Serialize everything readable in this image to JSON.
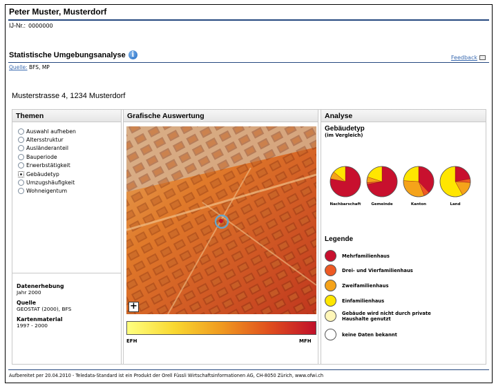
{
  "header": {
    "name": "Peter Muster, Musterdorf",
    "id_label": "IJ-Nr.:",
    "id_value": "0000000"
  },
  "section": {
    "title": "Statistische Umgebungsanalyse",
    "feedback": "Feedback",
    "source_link": "Quelle:",
    "source_value": "BFS, MP"
  },
  "address": "Musterstrasse 4, 1234 Musterdorf",
  "panels": {
    "themes_header": "Themen",
    "map_header": "Grafische Auswertung",
    "analysis_header": "Analyse"
  },
  "themes": [
    {
      "label": "Auswahl aufheben",
      "checked": false
    },
    {
      "label": "Altersstruktur",
      "checked": false
    },
    {
      "label": "Ausländeranteil",
      "checked": false
    },
    {
      "label": "Bauperiode",
      "checked": false
    },
    {
      "label": "Erwerbstätigkeit",
      "checked": false
    },
    {
      "label": "Gebäudetyp",
      "checked": true
    },
    {
      "label": "Umzugshäufigkeit",
      "checked": false
    },
    {
      "label": "Wohneigentum",
      "checked": false
    }
  ],
  "meta": {
    "erhebung_label": "Datenerhebung",
    "erhebung_value": "Jahr 2000",
    "quelle_label": "Quelle",
    "quelle_value": "GEOSTAT (2000), BFS",
    "karten_label": "Kartenmaterial",
    "karten_value": "1997 - 2000"
  },
  "map": {
    "zoom_button": "+",
    "scale_left": "EFH",
    "scale_right": "MFH"
  },
  "analysis": {
    "title": "Gebäudetyp",
    "subtitle": "(im Vergleich)",
    "pies": [
      {
        "label": "Nachbarschaft",
        "shares": [
          0.78,
          0.0,
          0.08,
          0.14,
          0.0
        ]
      },
      {
        "label": "Gemeinde",
        "shares": [
          0.72,
          0.02,
          0.06,
          0.2,
          0.0
        ]
      },
      {
        "label": "Kanton",
        "shares": [
          0.38,
          0.06,
          0.32,
          0.24,
          0.0
        ]
      },
      {
        "label": "Land",
        "shares": [
          0.22,
          0.04,
          0.16,
          0.58,
          0.0
        ]
      }
    ],
    "legend_title": "Legende",
    "legend": [
      {
        "label": "Mehrfamilienhaus",
        "color": "#c8102e"
      },
      {
        "label": "Drei- und Vierfamilienhaus",
        "color": "#ee5a24"
      },
      {
        "label": "Zweifamilienhaus",
        "color": "#f5a31a"
      },
      {
        "label": "Einfamilienhaus",
        "color": "#ffe600"
      },
      {
        "label": "Gebäude wird nicht durch private Haushalte genutzt",
        "color": "#fff6b8"
      },
      {
        "label": "keine Daten bekannt",
        "color": "#ffffff"
      }
    ]
  },
  "footer": "Aufbereitet per 20.04.2010 - Teledata-Standard ist ein Produkt der Orell Füssli Wirtschaftsinformationen AG, CH-8050 Zürich, www.ofwi.ch"
}
